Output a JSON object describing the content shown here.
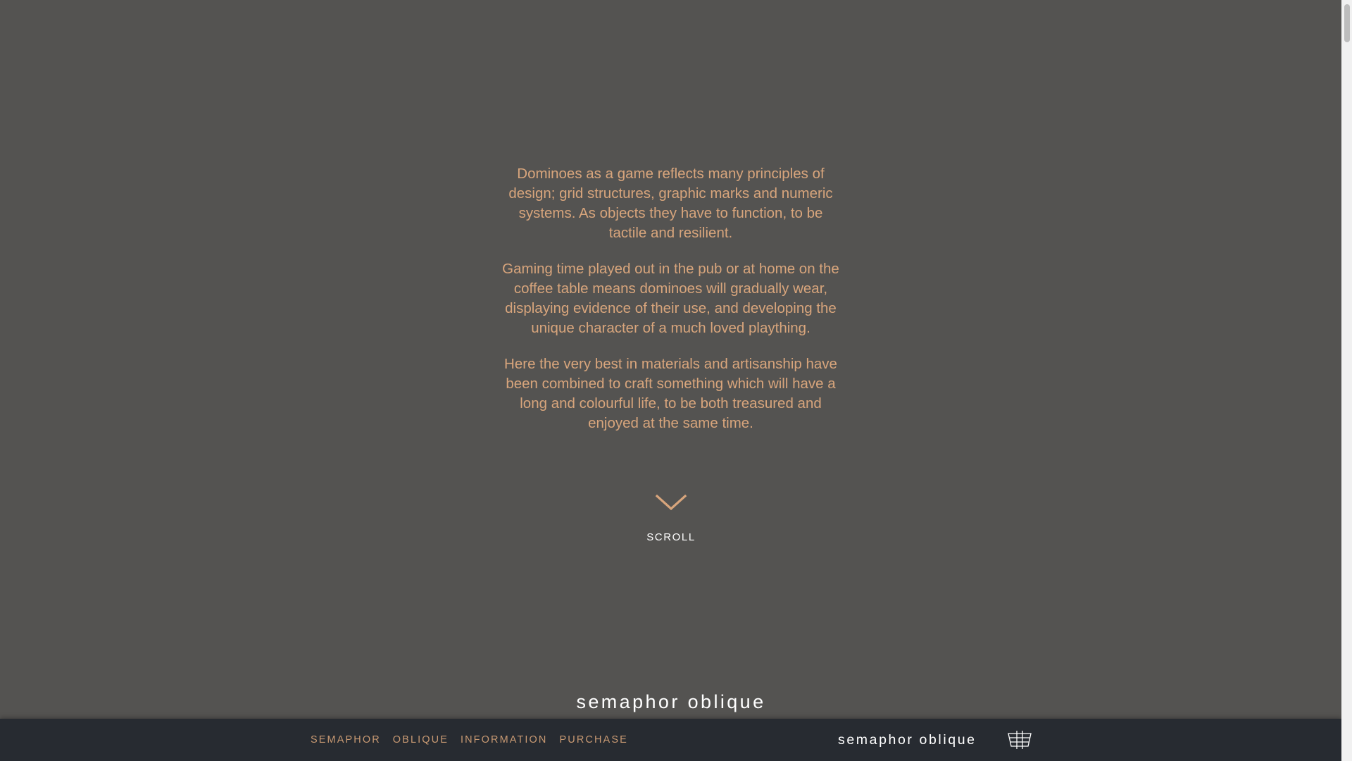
{
  "intro": {
    "paragraphs": [
      "Dominoes as a game reflects many principles of design; grid structures, graphic marks and numeric systems. As objects they have to function, to be tactile and resilient.",
      "Gaming time played out in the pub or at home on the coffee table means dominoes will gradually wear, displaying evidence of their use, and developing the unique character of a much loved plaything.",
      "Here the very best in materials and artisanship have been combined to craft something which will have a long and colourful life, to be both treasured and enjoyed at the same time."
    ]
  },
  "scroll": {
    "label": "SCROLL",
    "icon": "chevron-down-icon"
  },
  "brand_peek": "semaphor oblique",
  "navbar": {
    "links": [
      "SEMAPHOR",
      "OBLIQUE",
      "INFORMATION",
      "PURCHASE"
    ],
    "brand": "semaphor oblique",
    "logo_icon": "semaphor-logo-icon"
  },
  "colors": {
    "background": "#545351",
    "text_accent": "#d8a57c",
    "nav_background": "#272b31",
    "nav_link": "#c99a73"
  }
}
